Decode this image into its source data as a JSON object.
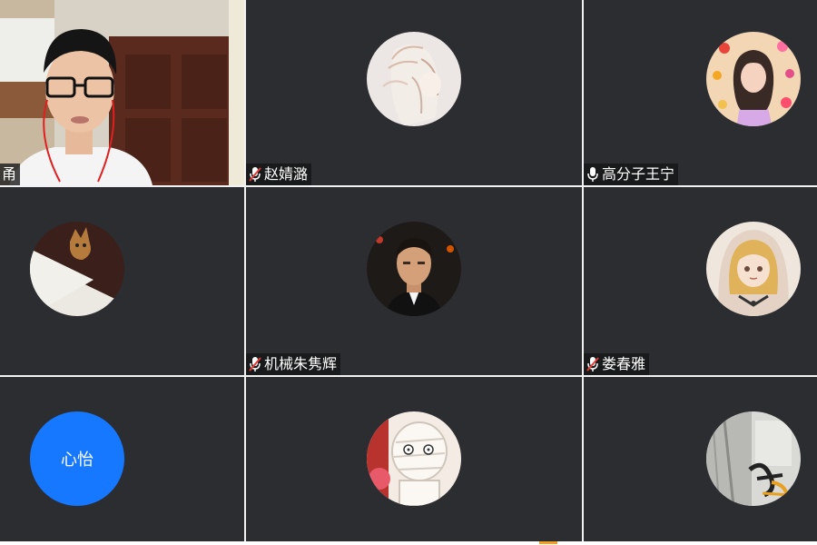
{
  "participants": [
    {
      "name": "",
      "mic": "camera-on",
      "video": true,
      "visible_name_fragment": "甬"
    },
    {
      "name": "赵婧潞",
      "mic": "muted",
      "avatar": "anime-sketch-girl"
    },
    {
      "name": "高分子王宁",
      "mic": "unmuted",
      "avatar": "girl-with-hearts"
    },
    {
      "name": "",
      "mic": "none",
      "avatar": "cat-photo"
    },
    {
      "name": "机械朱隽辉",
      "mic": "muted",
      "avatar": "man-in-suit"
    },
    {
      "name": "娄春雅",
      "mic": "muted",
      "avatar": "anime-girl-veil"
    },
    {
      "name": "",
      "mic": "none",
      "avatar_text": "心怡",
      "avatar_color": "#1677ff"
    },
    {
      "name": "",
      "mic": "none",
      "avatar": "mummy-cartoon"
    },
    {
      "name": "",
      "mic": "none",
      "avatar": "grayscale-calligraphy"
    }
  ],
  "colors": {
    "tile_bg": "#2b2d30",
    "grid_gap": "#f2f2f2",
    "text_avatar_blue": "#1677ff",
    "muted_icon_red": "#e53935",
    "name_tag_bg": "#141416"
  }
}
